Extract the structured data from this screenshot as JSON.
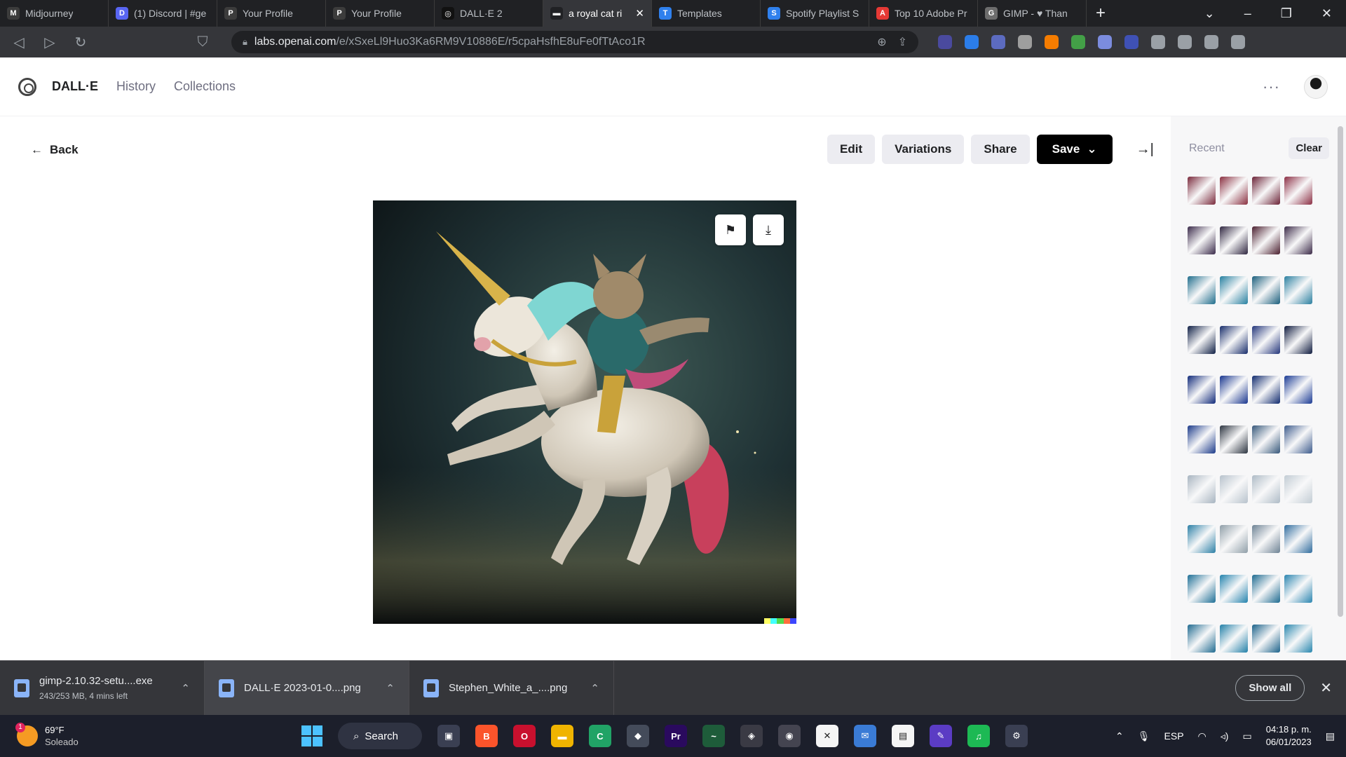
{
  "browser": {
    "tabs": [
      {
        "label": "Midjourney",
        "fav_color": "#3c3c3c",
        "fav_glyph": "M"
      },
      {
        "label": "(1) Discord | #ge",
        "fav_color": "#5865f2",
        "fav_glyph": "D"
      },
      {
        "label": "Your Profile",
        "fav_color": "#3c3c3c",
        "fav_glyph": "P"
      },
      {
        "label": "Your Profile",
        "fav_color": "#3c3c3c",
        "fav_glyph": "P"
      },
      {
        "label": "DALL·E 2",
        "fav_color": "#111111",
        "fav_glyph": "◎"
      },
      {
        "label": "a royal cat ri",
        "fav_color": "#202124",
        "fav_glyph": "▬",
        "active": true
      },
      {
        "label": "Templates",
        "fav_color": "#2f80ed",
        "fav_glyph": "T"
      },
      {
        "label": "Spotify Playlist S",
        "fav_color": "#2f80ed",
        "fav_glyph": "S"
      },
      {
        "label": "Top 10 Adobe Pr",
        "fav_color": "#e53935",
        "fav_glyph": "A"
      },
      {
        "label": "GIMP - ♥ Than",
        "fav_color": "#6d6d6d",
        "fav_glyph": "G"
      }
    ],
    "new_tab_glyph": "+",
    "window_controls": [
      "⌄",
      "–",
      "❐",
      "✕"
    ],
    "url_host": "labs.openai.com",
    "url_path": "/e/xSxeLl9Huo3Ka6RM9V10886E/r5cpaHsfhE8uFe0fTtAco1R",
    "extension_colors": [
      "#4a4a9e",
      "#2b7de9",
      "#5c6bc0",
      "#9e9e9e",
      "#f57c00",
      "#43a047",
      "#7b8cde",
      "#3f51b5",
      "#9aa0a6",
      "#9aa0a6",
      "#9aa0a6",
      "#9aa0a6"
    ]
  },
  "app": {
    "brand": "DALL·E",
    "nav": {
      "history": "History",
      "collections": "Collections"
    },
    "more_glyph": "···"
  },
  "toolbar": {
    "back_label": "Back",
    "edit_label": "Edit",
    "variations_label": "Variations",
    "share_label": "Share",
    "save_label": "Save",
    "collapse_glyph": "→|"
  },
  "image": {
    "flag_glyph": "⚑",
    "download_glyph": "⤓",
    "signature_colors": [
      "#ffff66",
      "#42ffff",
      "#51da4c",
      "#ff6e3c",
      "#3c46ff"
    ]
  },
  "sidebar": {
    "recent_label": "Recent",
    "clear_label": "Clear",
    "thumb_rows": [
      [
        "#7a2a3c",
        "#8a3040",
        "#6b2236",
        "#8c2f45"
      ],
      [
        "#3a2a4a",
        "#2f2640",
        "#4a1e2e",
        "#3b2a48"
      ],
      [
        "#1f6d8c",
        "#2680a0",
        "#1a5e7c",
        "#2a7fa0"
      ],
      [
        "#0f1f45",
        "#172c6a",
        "#23357a",
        "#0e1a3e"
      ],
      [
        "#112a7a",
        "#18358e",
        "#102a6e",
        "#1a3a94"
      ],
      [
        "#1b3a8a",
        "#2c3440",
        "#36577a",
        "#3c5a8c"
      ],
      [
        "#a7b4c0",
        "#b7c2cc",
        "#aebbc6",
        "#c2ccd4"
      ],
      [
        "#2b7fa6",
        "#8f9ea8",
        "#6d8294",
        "#2f6c9e"
      ],
      [
        "#1e6f96",
        "#2382ad",
        "#1d6a90",
        "#2a85b0"
      ],
      [
        "#1f6a90",
        "#2280a8",
        "#1b628a",
        "#2786ae"
      ]
    ]
  },
  "downloads": [
    {
      "name": "gimp-2.10.32-setu....exe",
      "sub": "243/253 MB, 4 mins left"
    },
    {
      "name": "DALL·E 2023-01-0....png",
      "sub": ""
    },
    {
      "name": "Stephen_White_a_....png",
      "sub": ""
    }
  ],
  "downloads_show_all": "Show all",
  "taskbar": {
    "weather_temp": "69°F",
    "weather_desc": "Soleado",
    "weather_badge": "1",
    "search_label": "Search",
    "apps": [
      {
        "glyph": "▣",
        "color": "#3a3f52"
      },
      {
        "glyph": "B",
        "color": "#fb542b"
      },
      {
        "glyph": "O",
        "color": "#c8102e"
      },
      {
        "glyph": "▬",
        "color": "#f0b400"
      },
      {
        "glyph": "C",
        "color": "#21a366"
      },
      {
        "glyph": "◆",
        "color": "#444b5a"
      },
      {
        "glyph": "Pr",
        "color": "#2a0a5e"
      },
      {
        "glyph": "~",
        "color": "#1e5c3a"
      },
      {
        "glyph": "◈",
        "color": "#3a3a44"
      },
      {
        "glyph": "◉",
        "color": "#444450"
      },
      {
        "glyph": "✕",
        "color": "#f5f5f5"
      },
      {
        "glyph": "✉",
        "color": "#3a7bd5"
      },
      {
        "glyph": "▤",
        "color": "#f5f5f5"
      },
      {
        "glyph": "✎",
        "color": "#5b3cc4"
      },
      {
        "glyph": "♫",
        "color": "#1db954"
      },
      {
        "glyph": "⚙",
        "color": "#3a3f52"
      }
    ],
    "tray_language": "ESP",
    "clock_time": "04:18 p. m.",
    "clock_date": "06/01/2023"
  }
}
